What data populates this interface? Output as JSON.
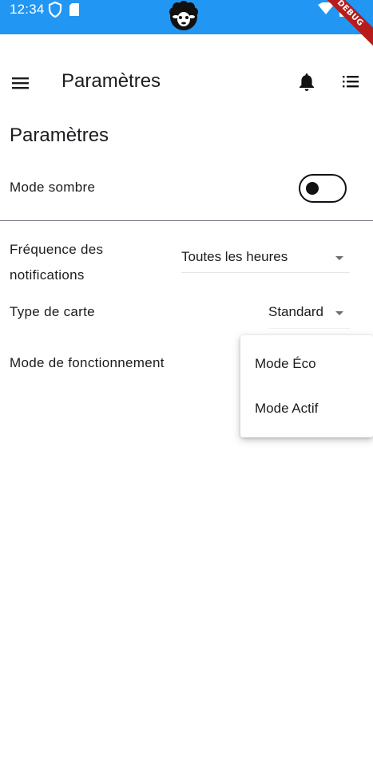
{
  "status_bar": {
    "time": "12:34",
    "icons": [
      "shield-icon",
      "sim-card-icon",
      "sheep-logo",
      "wifi-icon",
      "battery-icon"
    ],
    "color": "#2196f3"
  },
  "debug_banner": {
    "label": "DEBUG"
  },
  "app_bar": {
    "title": "Paramètres",
    "icons": [
      "menu-icon",
      "bell-icon",
      "list-icon"
    ]
  },
  "settings": {
    "section_title": "Paramètres",
    "dark_mode": {
      "label": "Mode sombre",
      "enabled": false
    },
    "notification_frequency": {
      "label": "Fréquence des notifications",
      "value": "Toutes les heures"
    },
    "map_type": {
      "label": "Type de carte",
      "value": "Standard"
    },
    "operating_mode": {
      "label": "Mode de fonctionnement",
      "options": [
        "Mode Éco",
        "Mode Actif"
      ]
    }
  }
}
